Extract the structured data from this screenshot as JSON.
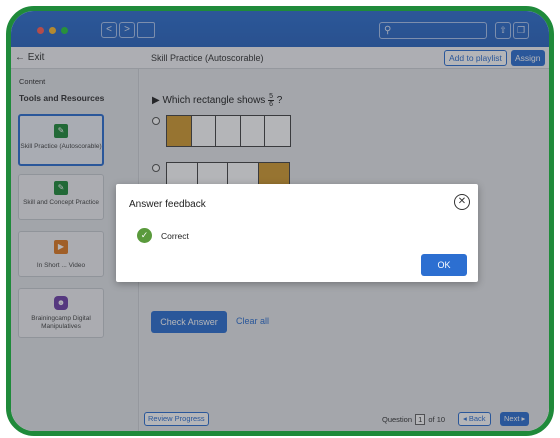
{
  "browser": {
    "nav_back": "<",
    "nav_forward": ">",
    "url_icon": "search-icon",
    "right_buttons": [
      "share-icon",
      "tabs-icon"
    ]
  },
  "header": {
    "exit_label": "← Exit",
    "page_title": "Skill Practice (Autoscorable)",
    "add_to_playlist": "Add to playlist",
    "assign": "Assign"
  },
  "sidebar": {
    "content_label": "Content",
    "section_title": "Tools and Resources",
    "items": [
      {
        "label": "Skill Practice (Autoscorable)",
        "icon": "practice-icon",
        "color": "#1f8a3a",
        "active": true
      },
      {
        "label": "Skill and Concept Practice",
        "icon": "practice-icon",
        "color": "#1f8a3a",
        "active": false
      },
      {
        "label": "In Short ... Video",
        "icon": "video-icon",
        "color": "#e07b22",
        "active": false
      },
      {
        "label": "Brainingcamp Digital Manipulatives",
        "icon": "brainingcamp-icon",
        "color": "#6d3fa8",
        "active": false
      }
    ]
  },
  "question": {
    "prompt": "Which rectangle shows",
    "fraction_num": "5",
    "fraction_den": "6",
    "suffix": "?",
    "options": [
      {
        "parts": 5,
        "filled_index": 0
      },
      {
        "parts": 4,
        "filled_index": 3
      }
    ]
  },
  "actions": {
    "check_answer": "Check Answer",
    "clear_all": "Clear all"
  },
  "footer": {
    "review_progress": "Review Progress",
    "question_label": "Question",
    "question_number": "1",
    "of_label": "of 10",
    "back": "◂ Back",
    "next": "Next ▸"
  },
  "modal": {
    "title": "Answer feedback",
    "result": "Correct",
    "ok": "OK"
  },
  "colors": {
    "accent": "#2c6fd1",
    "frame": "#1f8a3a",
    "fill": "#d39b30",
    "correct": "#5a9a3c"
  }
}
